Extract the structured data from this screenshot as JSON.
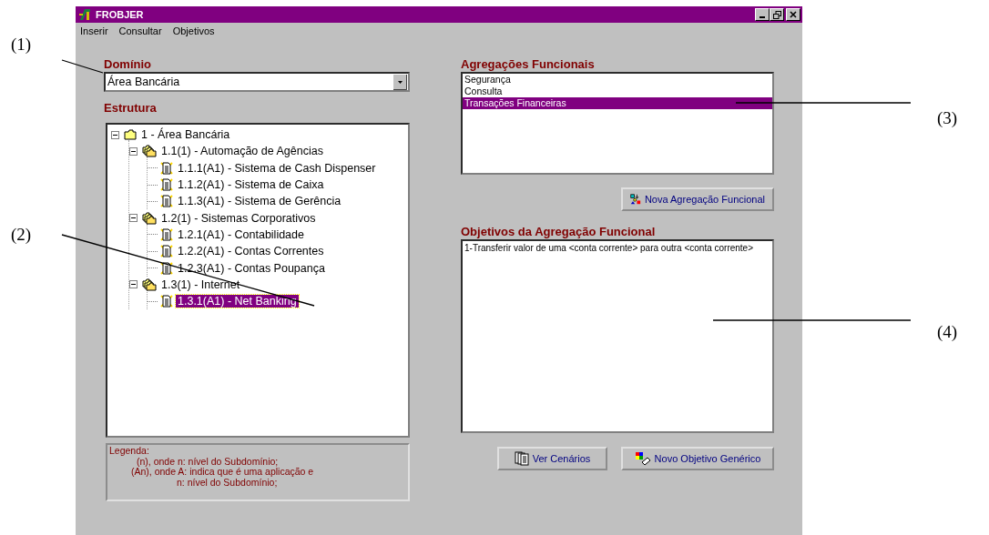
{
  "window": {
    "title": "FROBJER"
  },
  "menu": [
    {
      "label": "Inserir"
    },
    {
      "label": "Consultar"
    },
    {
      "label": "Objetivos"
    }
  ],
  "domain": {
    "label": "Domínio",
    "value": "Área Bancária"
  },
  "structure": {
    "label": "Estrutura",
    "tree": [
      {
        "label": "1 - Área Bancária",
        "kind": "root",
        "expanded": true,
        "selected": false,
        "children": [
          {
            "label": "1.1(1) - Automação de Agências",
            "kind": "group",
            "expanded": true,
            "selected": false,
            "children": [
              {
                "label": "1.1.1(A1) - Sistema de Cash Dispenser",
                "kind": "application",
                "selected": false
              },
              {
                "label": "1.1.2(A1) - Sistema de Caixa",
                "kind": "application",
                "selected": false
              },
              {
                "label": "1.1.3(A1) - Sistema de Gerência",
                "kind": "application",
                "selected": false
              }
            ]
          },
          {
            "label": "1.2(1) - Sistemas Corporativos",
            "kind": "group",
            "expanded": true,
            "selected": false,
            "children": [
              {
                "label": "1.2.1(A1) - Contabilidade",
                "kind": "application",
                "selected": false
              },
              {
                "label": "1.2.2(A1) - Contas Correntes",
                "kind": "application",
                "selected": false
              },
              {
                "label": "1.2.3(A1) - Contas Poupança",
                "kind": "application",
                "selected": false
              }
            ]
          },
          {
            "label": "1.3(1) - Internet",
            "kind": "group",
            "expanded": true,
            "selected": false,
            "children": [
              {
                "label": "1.3.1(A1) - Net Banking",
                "kind": "application",
                "selected": true
              }
            ]
          }
        ]
      }
    ]
  },
  "legend": [
    "Legenda:",
    "(n), onde n: nível do Subdomínio;",
    "(An), onde A: indica que é uma aplicação e",
    "n: nível do Subdomínio;"
  ],
  "aggregations": {
    "label": "Agregações Funcionais",
    "items": [
      {
        "label": "Segurança",
        "selected": false
      },
      {
        "label": "Consulta",
        "selected": false
      },
      {
        "label": "Transações Financeiras",
        "selected": true
      }
    ]
  },
  "new_aggregation_button": "Nova Agregação Funcional",
  "objectives": {
    "label": "Objetivos da Agregação Funcional",
    "items": [
      "1-Transferir valor de uma <conta corrente> para outra <conta corrente>"
    ]
  },
  "buttons": [
    {
      "label": "Ver Cenários",
      "kind": "scenarios"
    },
    {
      "label": "Novo Objetivo Genérico",
      "kind": "objective"
    }
  ],
  "callouts": [
    "(1)",
    "(2)",
    "(3)",
    "(4)"
  ]
}
